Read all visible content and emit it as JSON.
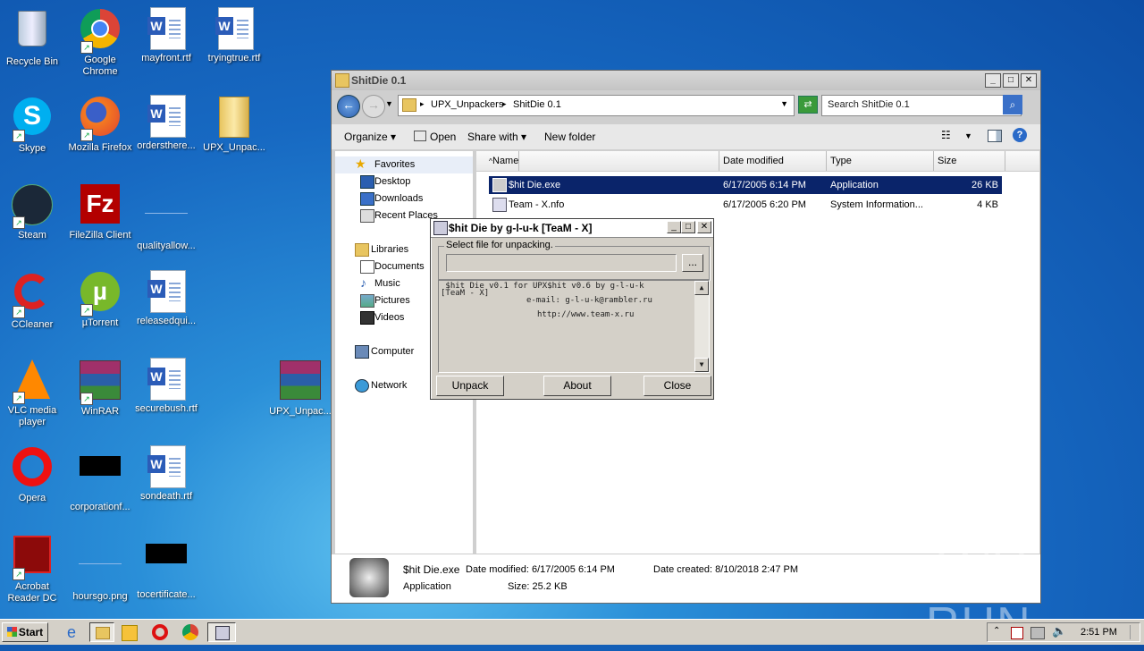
{
  "desktop": {
    "icons": [
      {
        "label": "Recycle Bin"
      },
      {
        "label": "Google Chrome"
      },
      {
        "label": "mayfront.rtf"
      },
      {
        "label": "tryingtrue.rtf"
      },
      {
        "label": "Skype"
      },
      {
        "label": "Mozilla Firefox"
      },
      {
        "label": "ordersthere..."
      },
      {
        "label": "UPX_Unpac..."
      },
      {
        "label": "Steam"
      },
      {
        "label": "FileZilla Client"
      },
      {
        "label": "qualityallow..."
      },
      {
        "label": "CCleaner"
      },
      {
        "label": "µTorrent"
      },
      {
        "label": "releasedqui..."
      },
      {
        "label": "VLC media player"
      },
      {
        "label": "WinRAR"
      },
      {
        "label": "securebush.rtf"
      },
      {
        "label": "UPX_Unpac..."
      },
      {
        "label": "Opera"
      },
      {
        "label": "corporationf..."
      },
      {
        "label": "sondeath.rtf"
      },
      {
        "label": "Acrobat Reader DC"
      },
      {
        "label": "hoursgo.png"
      },
      {
        "label": "tocertificate..."
      }
    ]
  },
  "explorer": {
    "title": "ShitDie 0.1",
    "breadcrumb": [
      "UPX_Unpackers",
      "ShitDie 0.1"
    ],
    "search_placeholder": "Search ShitDie 0.1",
    "toolbar": {
      "organize": "Organize",
      "open": "Open",
      "share_with": "Share with",
      "new_folder": "New folder"
    },
    "nav": [
      {
        "label": "Favorites"
      },
      {
        "label": "Desktop"
      },
      {
        "label": "Downloads"
      },
      {
        "label": "Recent Places"
      },
      {
        "label": "Libraries"
      },
      {
        "label": "Documents"
      },
      {
        "label": "Music"
      },
      {
        "label": "Pictures"
      },
      {
        "label": "Videos"
      },
      {
        "label": "Computer"
      },
      {
        "label": "Network"
      }
    ],
    "columns": {
      "name": "Name",
      "date": "Date modified",
      "type": "Type",
      "size": "Size"
    },
    "files": [
      {
        "name": "$hit Die.exe",
        "date": "6/17/2005 6:14 PM",
        "type": "Application",
        "size": "26 KB"
      },
      {
        "name": "Team - X.nfo",
        "date": "6/17/2005 6:20 PM",
        "type": "System Information...",
        "size": "4 KB"
      }
    ],
    "details": {
      "name": "$hit Die.exe",
      "modified": "Date modified: 6/17/2005 6:14 PM",
      "created": "Date created: 8/10/2018 2:47 PM",
      "type": "Application",
      "size": "Size: 25.2 KB"
    }
  },
  "dialog": {
    "title": "$hit Die by g-l-u-k [TeaM - X]",
    "group_label": "Select file for unpacking.",
    "browse_label": "...",
    "memo_line1": " $hit Die v0.1 for UPX$hit v0.6 by g-l-u-k",
    "memo_line2": "[TeaM - X]",
    "memo_line3": "e-mail: g-l-u-k@rambler.ru",
    "memo_line4": "http://www.team-x.ru",
    "unpack": "Unpack",
    "about": "About",
    "close": "Close"
  },
  "taskbar": {
    "start": "Start",
    "clock": "2:51 PM"
  },
  "watermark": "ANY RUN"
}
